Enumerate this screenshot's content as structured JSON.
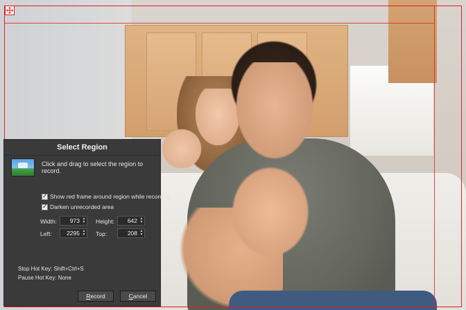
{
  "dialog": {
    "title": "Select Region",
    "description": "Click and drag to select the region to record.",
    "options": {
      "show_frame": {
        "label": "Show red frame around region while recording",
        "checked": true
      },
      "darken": {
        "label": "Darken unrecorded area",
        "checked": true
      }
    },
    "fields": {
      "width": {
        "label": "Width:",
        "value": "973"
      },
      "height": {
        "label": "Height:",
        "value": "642"
      },
      "left": {
        "label": "Left:",
        "value": "2295"
      },
      "top": {
        "label": "Top:",
        "value": "208"
      }
    },
    "hotkeys": {
      "stop": "Stop Hot Key: Shift+Ctrl+S",
      "pause": "Pause Hot Key: None"
    },
    "buttons": {
      "record_accel": "R",
      "record_rest": "ecord",
      "cancel_accel": "C",
      "cancel_rest": "ancel"
    }
  },
  "colors": {
    "frame": "#e02020",
    "dialog_bg": "#3a3a3a"
  },
  "icons": {
    "move_handle": "move-arrows-icon",
    "thumbnail": "desktop-preview-icon"
  }
}
